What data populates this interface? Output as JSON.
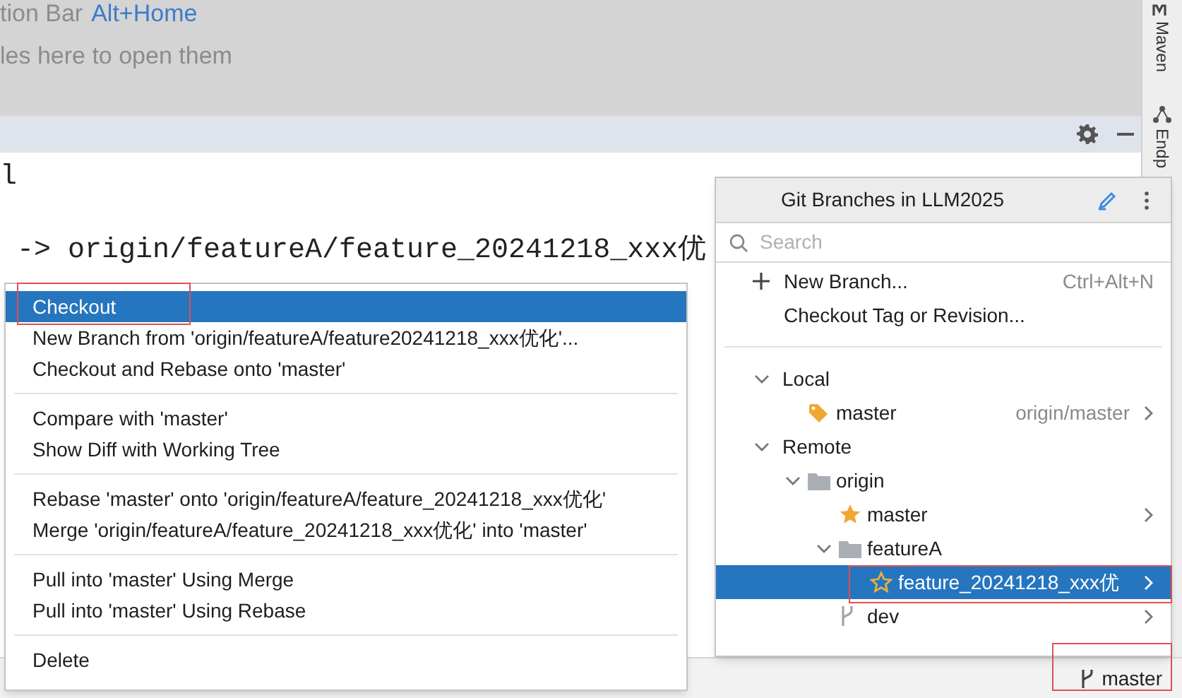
{
  "top_panel": {
    "hint_line": "tion Bar",
    "shortcut": "Alt+Home",
    "drop_hint": "les here to open them"
  },
  "side_tools": [
    "Maven",
    "Endp"
  ],
  "editor": {
    "lines": [
      "l",
      "-> origin/featureA/feature_20241218_xxx优"
    ]
  },
  "context_menu": {
    "groups": [
      [
        {
          "label": "Checkout",
          "selected": true
        },
        {
          "label": "New Branch from 'origin/featureA/feature20241218_xxx优化'...",
          "selected": false
        },
        {
          "label": "Checkout and Rebase onto 'master'",
          "selected": false
        }
      ],
      [
        {
          "label": "Compare with 'master'",
          "selected": false
        },
        {
          "label": "Show Diff with Working Tree",
          "selected": false
        }
      ],
      [
        {
          "label": "Rebase 'master' onto 'origin/featureA/feature_20241218_xxx优化'",
          "selected": false
        },
        {
          "label": "Merge 'origin/featureA/feature_20241218_xxx优化' into 'master'",
          "selected": false
        }
      ],
      [
        {
          "label": "Pull into 'master' Using Merge",
          "selected": false
        },
        {
          "label": "Pull into 'master' Using Rebase",
          "selected": false
        }
      ],
      [
        {
          "label": "Delete",
          "selected": false
        }
      ]
    ]
  },
  "branches_popup": {
    "title": "Git Branches in LLM2025",
    "search": {
      "placeholder": "Search"
    },
    "actions": [
      {
        "label": "New Branch...",
        "shortcut": "Ctrl+Alt+N",
        "kind": "new"
      },
      {
        "label": "Checkout Tag or Revision...",
        "kind": "plain"
      }
    ],
    "tree": [
      {
        "label": "Local",
        "kind": "group",
        "expanded": true,
        "selected": false,
        "children": [
          {
            "label": "master",
            "kind": "tracked",
            "hint": "origin/master",
            "selected": false
          }
        ]
      },
      {
        "label": "Remote",
        "kind": "group",
        "expanded": true,
        "selected": false,
        "children": [
          {
            "label": "origin",
            "kind": "folder",
            "expanded": true,
            "selected": false,
            "children": [
              {
                "label": "master",
                "kind": "favorite",
                "selected": false
              },
              {
                "label": "featureA",
                "kind": "folder",
                "expanded": true,
                "selected": false,
                "children": [
                  {
                    "label": "feature_20241218_xxx优",
                    "kind": "favorite-outline",
                    "selected": true
                  }
                ]
              },
              {
                "label": "dev",
                "kind": "branch",
                "selected": false
              }
            ]
          }
        ]
      }
    ]
  },
  "status_bar": {
    "branch": "master"
  }
}
